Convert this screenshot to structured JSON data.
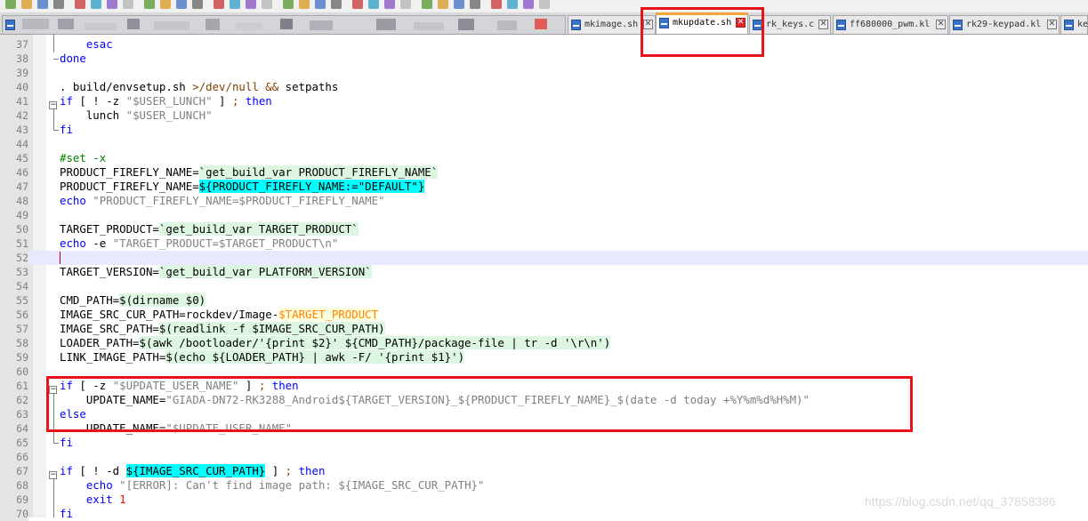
{
  "toolbar": {
    "icons": [
      "new-file-icon",
      "open-file-icon",
      "save-icon",
      "save-all-icon",
      "close-icon",
      "close-all-icon",
      "print-icon",
      "cut-icon",
      "copy-icon",
      "paste-icon",
      "undo-icon",
      "redo-icon",
      "find-icon",
      "replace-icon",
      "zoom-in-icon",
      "zoom-out-icon",
      "sync-v-icon",
      "sync-h-icon",
      "wrap-icon",
      "all-chars-icon",
      "indent-guide-icon",
      "udl-icon",
      "doc-map-icon",
      "function-list-icon",
      "folder-workspace-icon",
      "monitoring-icon",
      "record-macro-icon",
      "stop-record-icon",
      "play-macro-icon",
      "play-multiple-icon",
      "save-macro-icon",
      "spell-icon"
    ]
  },
  "tabs": [
    {
      "name": "mkimage.sh",
      "active": false
    },
    {
      "name": "mkupdate.sh",
      "active": true
    },
    {
      "name": "rk_keys.c",
      "active": false
    },
    {
      "name": "ff680000_pwm.kl",
      "active": false
    },
    {
      "name": "rk29-keypad.kl",
      "active": false
    },
    {
      "name": "ke",
      "active": false
    }
  ],
  "close_glyph": "✕",
  "fold_glyphs": {
    "expand": "−"
  },
  "lines": [
    {
      "n": "37",
      "t": [
        [
          "    ",
          ""
        ],
        [
          "esac",
          "kw"
        ]
      ]
    },
    {
      "n": "38",
      "t": [
        [
          "done",
          "kw"
        ]
      ]
    },
    {
      "n": "39",
      "t": []
    },
    {
      "n": "40",
      "t": [
        [
          ". build/envsetup.sh ",
          ""
        ],
        [
          ">/dev/null && ",
          "op"
        ],
        [
          "setpaths",
          ""
        ]
      ]
    },
    {
      "n": "41",
      "t": [
        [
          "if",
          "kw"
        ],
        [
          " [ ! -z ",
          ""
        ],
        [
          "\"$USER_LUNCH\"",
          "str"
        ],
        [
          " ] ",
          ""
        ],
        [
          ";",
          "op"
        ],
        [
          " ",
          ""
        ],
        [
          "then",
          "kw"
        ]
      ]
    },
    {
      "n": "42",
      "t": [
        [
          "    lunch ",
          ""
        ],
        [
          "\"$USER_LUNCH\"",
          "str"
        ]
      ]
    },
    {
      "n": "43",
      "t": [
        [
          "fi",
          "kw"
        ]
      ]
    },
    {
      "n": "44",
      "t": []
    },
    {
      "n": "45",
      "t": [
        [
          "#set -x",
          "cmt"
        ]
      ]
    },
    {
      "n": "46",
      "t": [
        [
          "PRODUCT_FIREFLY_NAME=",
          ""
        ],
        [
          "`get_build_var PRODUCT_FIREFLY_NAME`",
          "bt"
        ]
      ]
    },
    {
      "n": "47",
      "t": [
        [
          "PRODUCT_FIREFLY_NAME=",
          ""
        ],
        [
          "${PRODUCT_FIREFLY_NAME:=\"DEFAULT\"}",
          "par"
        ]
      ]
    },
    {
      "n": "48",
      "t": [
        [
          "echo",
          "kw"
        ],
        [
          " ",
          ""
        ],
        [
          "\"PRODUCT_FIREFLY_NAME=$PRODUCT_FIREFLY_NAME\"",
          "str"
        ]
      ]
    },
    {
      "n": "49",
      "t": []
    },
    {
      "n": "50",
      "t": [
        [
          "TARGET_PRODUCT=",
          ""
        ],
        [
          "`get_build_var TARGET_PRODUCT`",
          "bt"
        ]
      ]
    },
    {
      "n": "51",
      "t": [
        [
          "echo",
          "kw"
        ],
        [
          " -e ",
          ""
        ],
        [
          "\"TARGET_PRODUCT=$TARGET_PRODUCT\\n\"",
          "str"
        ]
      ]
    },
    {
      "n": "52",
      "t": [],
      "current": true
    },
    {
      "n": "53",
      "t": [
        [
          "TARGET_VERSION=",
          ""
        ],
        [
          "`get_build_var PLATFORM_VERSION`",
          "bt"
        ]
      ]
    },
    {
      "n": "54",
      "t": []
    },
    {
      "n": "55",
      "t": [
        [
          "CMD_PATH=",
          ""
        ],
        [
          "$(dirname $0)",
          "sub"
        ]
      ]
    },
    {
      "n": "56",
      "t": [
        [
          "IMAGE_SRC_CUR_PATH=rockdev/Image-",
          ""
        ],
        [
          "$TARGET_PRODUCT",
          "var"
        ]
      ]
    },
    {
      "n": "57",
      "t": [
        [
          "IMAGE_SRC_PATH=",
          ""
        ],
        [
          "$(readlink -f $IMAGE_SRC_CUR_PATH)",
          "sub"
        ]
      ]
    },
    {
      "n": "58",
      "t": [
        [
          "LOADER_PATH=",
          ""
        ],
        [
          "$(awk /bootloader/'{print $2}' ${CMD_PATH}/package-file | tr -d '\\r\\n')",
          "sub"
        ]
      ]
    },
    {
      "n": "59",
      "t": [
        [
          "LINK_IMAGE_PATH=",
          ""
        ],
        [
          "$(echo ${LOADER_PATH} | awk -F/ '{print $1}')",
          "sub"
        ]
      ]
    },
    {
      "n": "60",
      "t": []
    },
    {
      "n": "61",
      "t": [
        [
          "if",
          "kw"
        ],
        [
          " [ -z ",
          ""
        ],
        [
          "\"$UPDATE_USER_NAME\"",
          "str"
        ],
        [
          " ] ",
          ""
        ],
        [
          ";",
          "op"
        ],
        [
          " ",
          ""
        ],
        [
          "then",
          "kw"
        ]
      ]
    },
    {
      "n": "62",
      "t": [
        [
          "    UPDATE_NAME=",
          ""
        ],
        [
          "\"GIADA-DN72-RK3288_Android${TARGET_VERSION}_${PRODUCT_FIREFLY_NAME}_$(date -d today +%Y%m%d%H%M)\"",
          "str"
        ]
      ]
    },
    {
      "n": "63",
      "t": [
        [
          "else",
          "kw"
        ]
      ]
    },
    {
      "n": "64",
      "t": [
        [
          "    UPDATE_NAME=",
          ""
        ],
        [
          "\"$UPDATE_USER_NAME\"",
          "str"
        ]
      ]
    },
    {
      "n": "65",
      "t": [
        [
          "fi",
          "kw"
        ]
      ]
    },
    {
      "n": "66",
      "t": []
    },
    {
      "n": "67",
      "t": [
        [
          "if",
          "kw"
        ],
        [
          " [ ! -d ",
          ""
        ],
        [
          "${IMAGE_SRC_CUR_PATH}",
          "par"
        ],
        [
          " ] ",
          ""
        ],
        [
          ";",
          "op"
        ],
        [
          " ",
          ""
        ],
        [
          "then",
          "kw"
        ]
      ]
    },
    {
      "n": "68",
      "t": [
        [
          "    ",
          ""
        ],
        [
          "echo",
          "kw"
        ],
        [
          " ",
          ""
        ],
        [
          "\"[ERROR]: Can't find image path: ${IMAGE_SRC_CUR_PATH}\"",
          "str"
        ]
      ]
    },
    {
      "n": "69",
      "t": [
        [
          "    ",
          ""
        ],
        [
          "exit",
          "kw"
        ],
        [
          " ",
          ""
        ],
        [
          "1",
          "num"
        ]
      ]
    },
    {
      "n": "70",
      "t": [
        [
          "fi",
          "kw"
        ]
      ]
    }
  ],
  "watermark": "https://blog.csdn.net/qq_37858386",
  "colors": {
    "highlight_box": "#e8121b",
    "active_tab_accent": "#f5a238"
  }
}
